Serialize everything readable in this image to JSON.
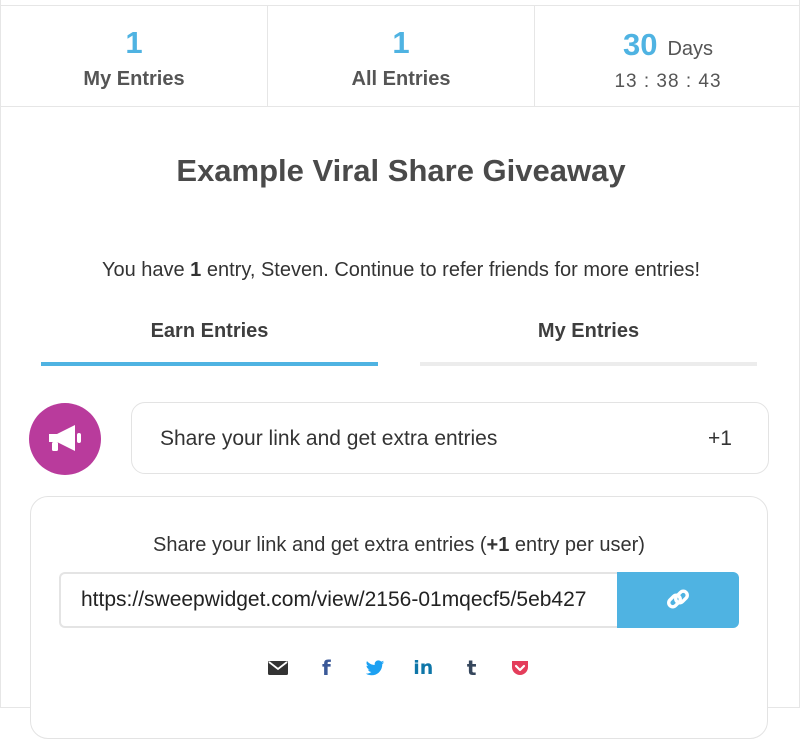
{
  "stats": {
    "my_entries": {
      "value": "1",
      "label": "My Entries"
    },
    "all_entries": {
      "value": "1",
      "label": "All Entries"
    },
    "countdown": {
      "days": "30",
      "days_label": "Days",
      "time": "13 : 38 : 43"
    }
  },
  "giveaway": {
    "title": "Example Viral Share Giveaway",
    "subtitle_pre": "You have ",
    "subtitle_count": "1",
    "subtitle_post": " entry, Steven. Continue to refer friends for more entries!"
  },
  "tabs": [
    {
      "label": "Earn Entries",
      "active": true
    },
    {
      "label": "My Entries",
      "active": false
    }
  ],
  "action": {
    "icon": "megaphone-icon",
    "text": "Share your link and get extra entries",
    "points": "+1"
  },
  "share": {
    "heading_pre": "Share your link and get extra entries (",
    "heading_bold": "+1",
    "heading_post": " entry per user)",
    "link_value": "https://sweepwidget.com/view/2156-01mqecf5/5eb427",
    "copy_icon": "link-icon",
    "social": [
      {
        "name": "email-icon"
      },
      {
        "name": "facebook-icon",
        "glyph": "f"
      },
      {
        "name": "twitter-icon"
      },
      {
        "name": "linkedin-icon",
        "glyph": "in"
      },
      {
        "name": "tumblr-icon",
        "glyph": "t"
      },
      {
        "name": "pocket-icon"
      }
    ]
  },
  "colors": {
    "accent": "#4fb3e2",
    "action_icon_bg": "#b93b9c",
    "pocket": "#e43d5b",
    "twitter": "#1da1f2"
  }
}
